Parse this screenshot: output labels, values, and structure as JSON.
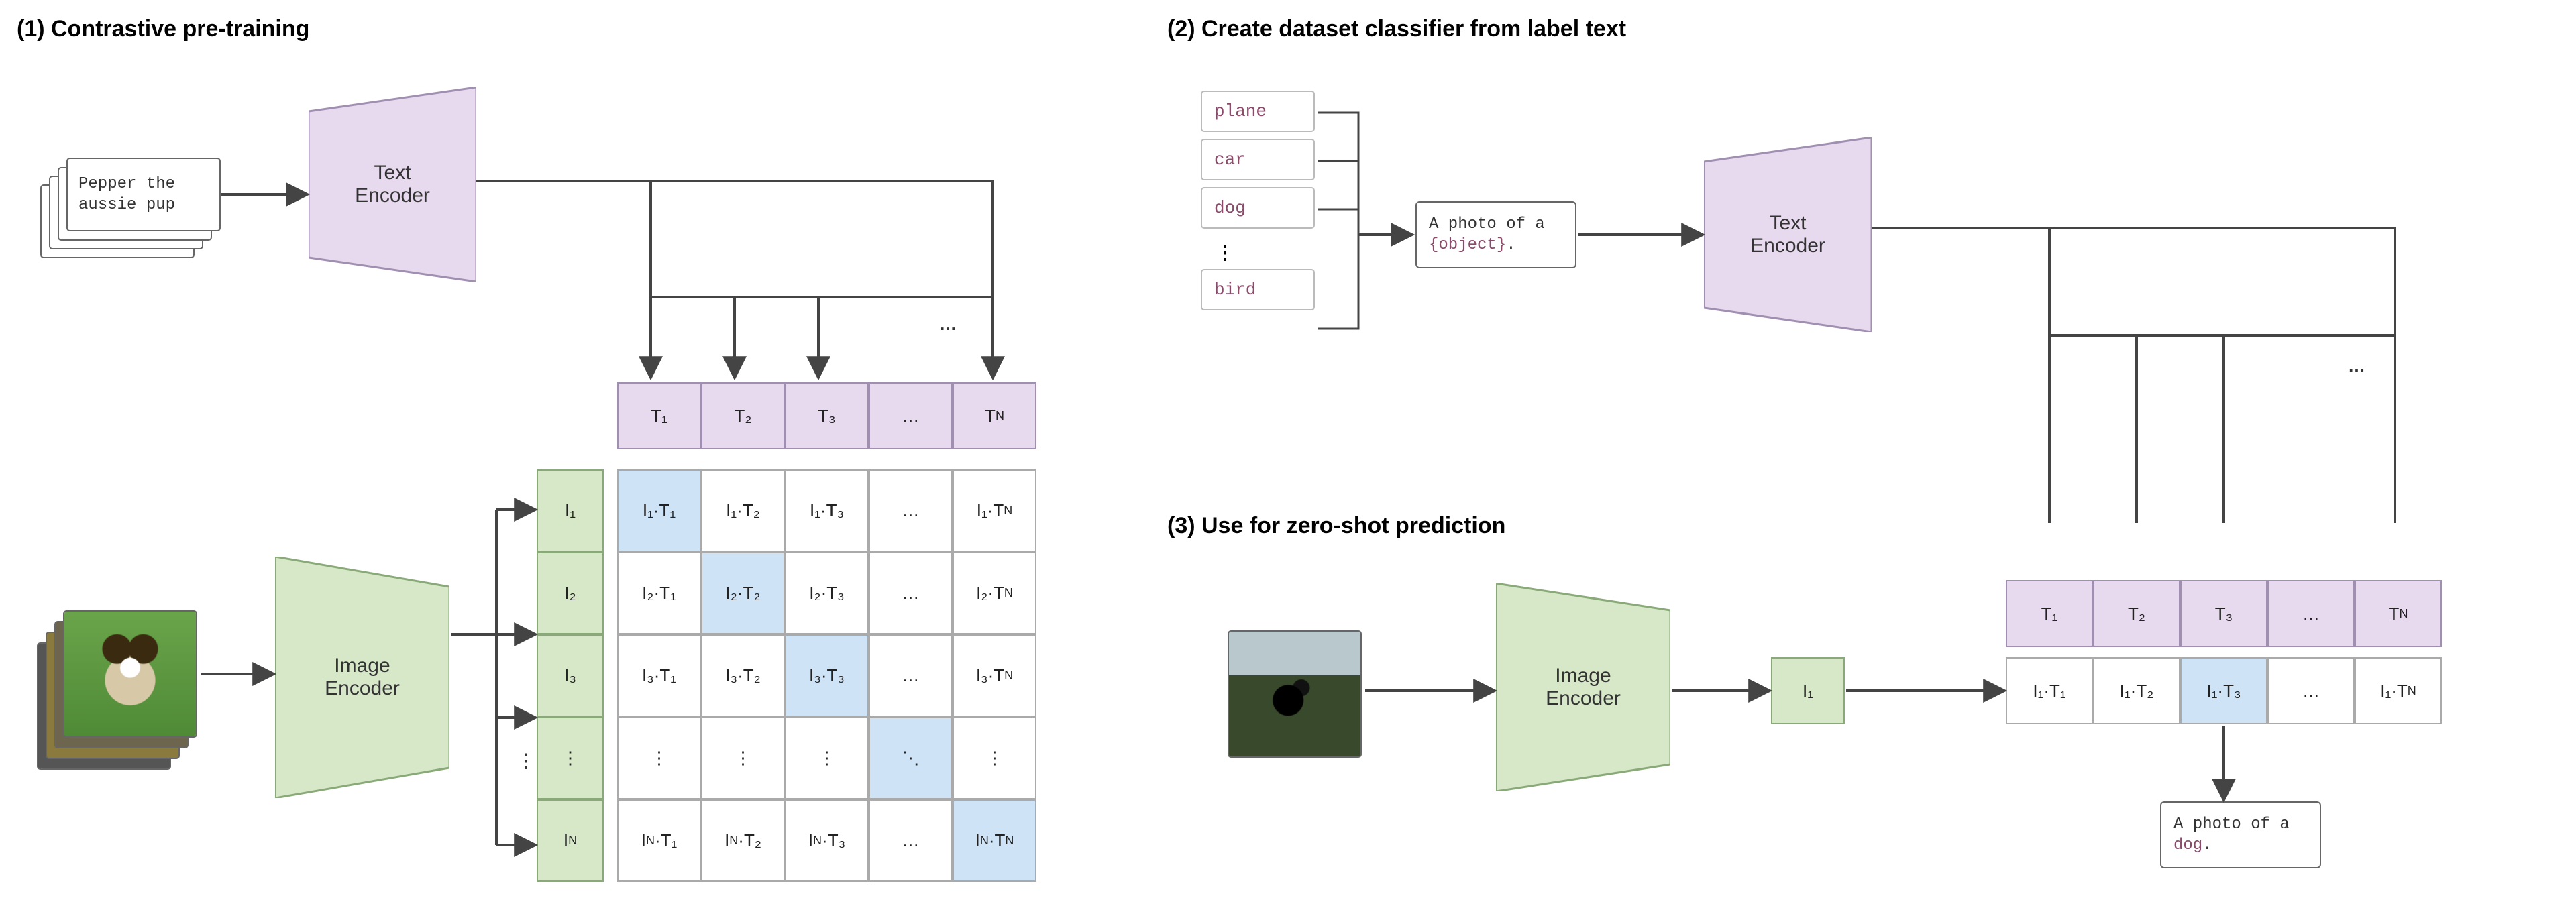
{
  "colors": {
    "purple_fill": "#e7d9ee",
    "purple_stroke": "#a08fb0",
    "green_fill": "#d7e8c9",
    "green_stroke": "#8aa978",
    "blue_highlight": "#cfe3f6",
    "arrow": "#444444"
  },
  "panel1": {
    "title": "(1) Contrastive pre-training",
    "caption": "Pepper the aussie pup",
    "text_encoder": "Text\nEncoder",
    "image_encoder": "Image\nEncoder",
    "col_heads": [
      "T₁",
      "T₂",
      "T₃",
      "…",
      "T_N"
    ],
    "row_heads": [
      "I₁",
      "I₂",
      "I₃",
      "⋮",
      "I_N"
    ],
    "matrix": [
      [
        "I₁·T₁",
        "I₁·T₂",
        "I₁·T₃",
        "…",
        "I₁·T_N"
      ],
      [
        "I₂·T₁",
        "I₂·T₂",
        "I₂·T₃",
        "…",
        "I₂·T_N"
      ],
      [
        "I₃·T₁",
        "I₃·T₂",
        "I₃·T₃",
        "…",
        "I₃·T_N"
      ],
      [
        "⋮",
        "⋮",
        "⋮",
        "⋱",
        "⋮"
      ],
      [
        "I_N·T₁",
        "I_N·T₂",
        "I_N·T₃",
        "…",
        "I_N·T_N"
      ]
    ],
    "ellipsis_top": "…"
  },
  "panel2": {
    "title": "(2) Create dataset classifier from label text",
    "labels": [
      "plane",
      "car",
      "dog",
      "bird"
    ],
    "label_ellipsis": "⋮",
    "prompt_prefix": "A photo of a ",
    "prompt_object": "{object}",
    "prompt_suffix": ".",
    "text_encoder": "Text\nEncoder",
    "ellipsis_top": "…"
  },
  "panel3": {
    "title": "(3) Use for zero-shot prediction",
    "image_encoder": "Image\nEncoder",
    "img_head": "I₁",
    "col_heads": [
      "T₁",
      "T₂",
      "T₃",
      "…",
      "T_N"
    ],
    "row": [
      "I₁·T₁",
      "I₁·T₂",
      "I₁·T₃",
      "…",
      "I₁·T_N"
    ],
    "highlight_col": 2,
    "result_prefix": "A photo of a ",
    "result_word": "dog",
    "result_suffix": "."
  }
}
